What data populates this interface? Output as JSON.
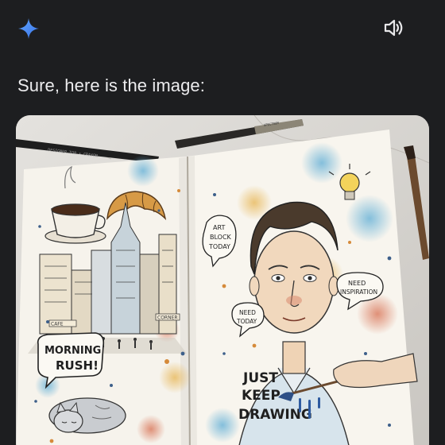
{
  "response": {
    "text": "Sure, here is the image:"
  },
  "icons": {
    "assistant": "gemini-spark-icon",
    "speaker": "speaker-icon"
  },
  "colors": {
    "background": "#1d1e20",
    "text": "#ececee",
    "spark": "#4b8df8"
  },
  "image": {
    "pencil_label": "DESIGNER TOP • CRAYON",
    "brush_label": "SPECTRUM",
    "bubble_art_block_1": "ART",
    "bubble_art_block_2": "BLOCK",
    "bubble_art_block_3": "TODAY",
    "bubble_need_inspiration_1": "NEED",
    "bubble_need_inspiration_2": "INSPIRATION",
    "bubble_need_today_1": "NEED",
    "bubble_need_today_2": "TODAY",
    "bubble_morning_rush_1": "MORNING",
    "bubble_morning_rush_2": "RUSH!",
    "caption_line_1": "JUST",
    "caption_line_2": "KEEP",
    "caption_line_3": "DRAWING",
    "shop_sign_1": "CAFE",
    "shop_sign_2": "CORNER"
  }
}
